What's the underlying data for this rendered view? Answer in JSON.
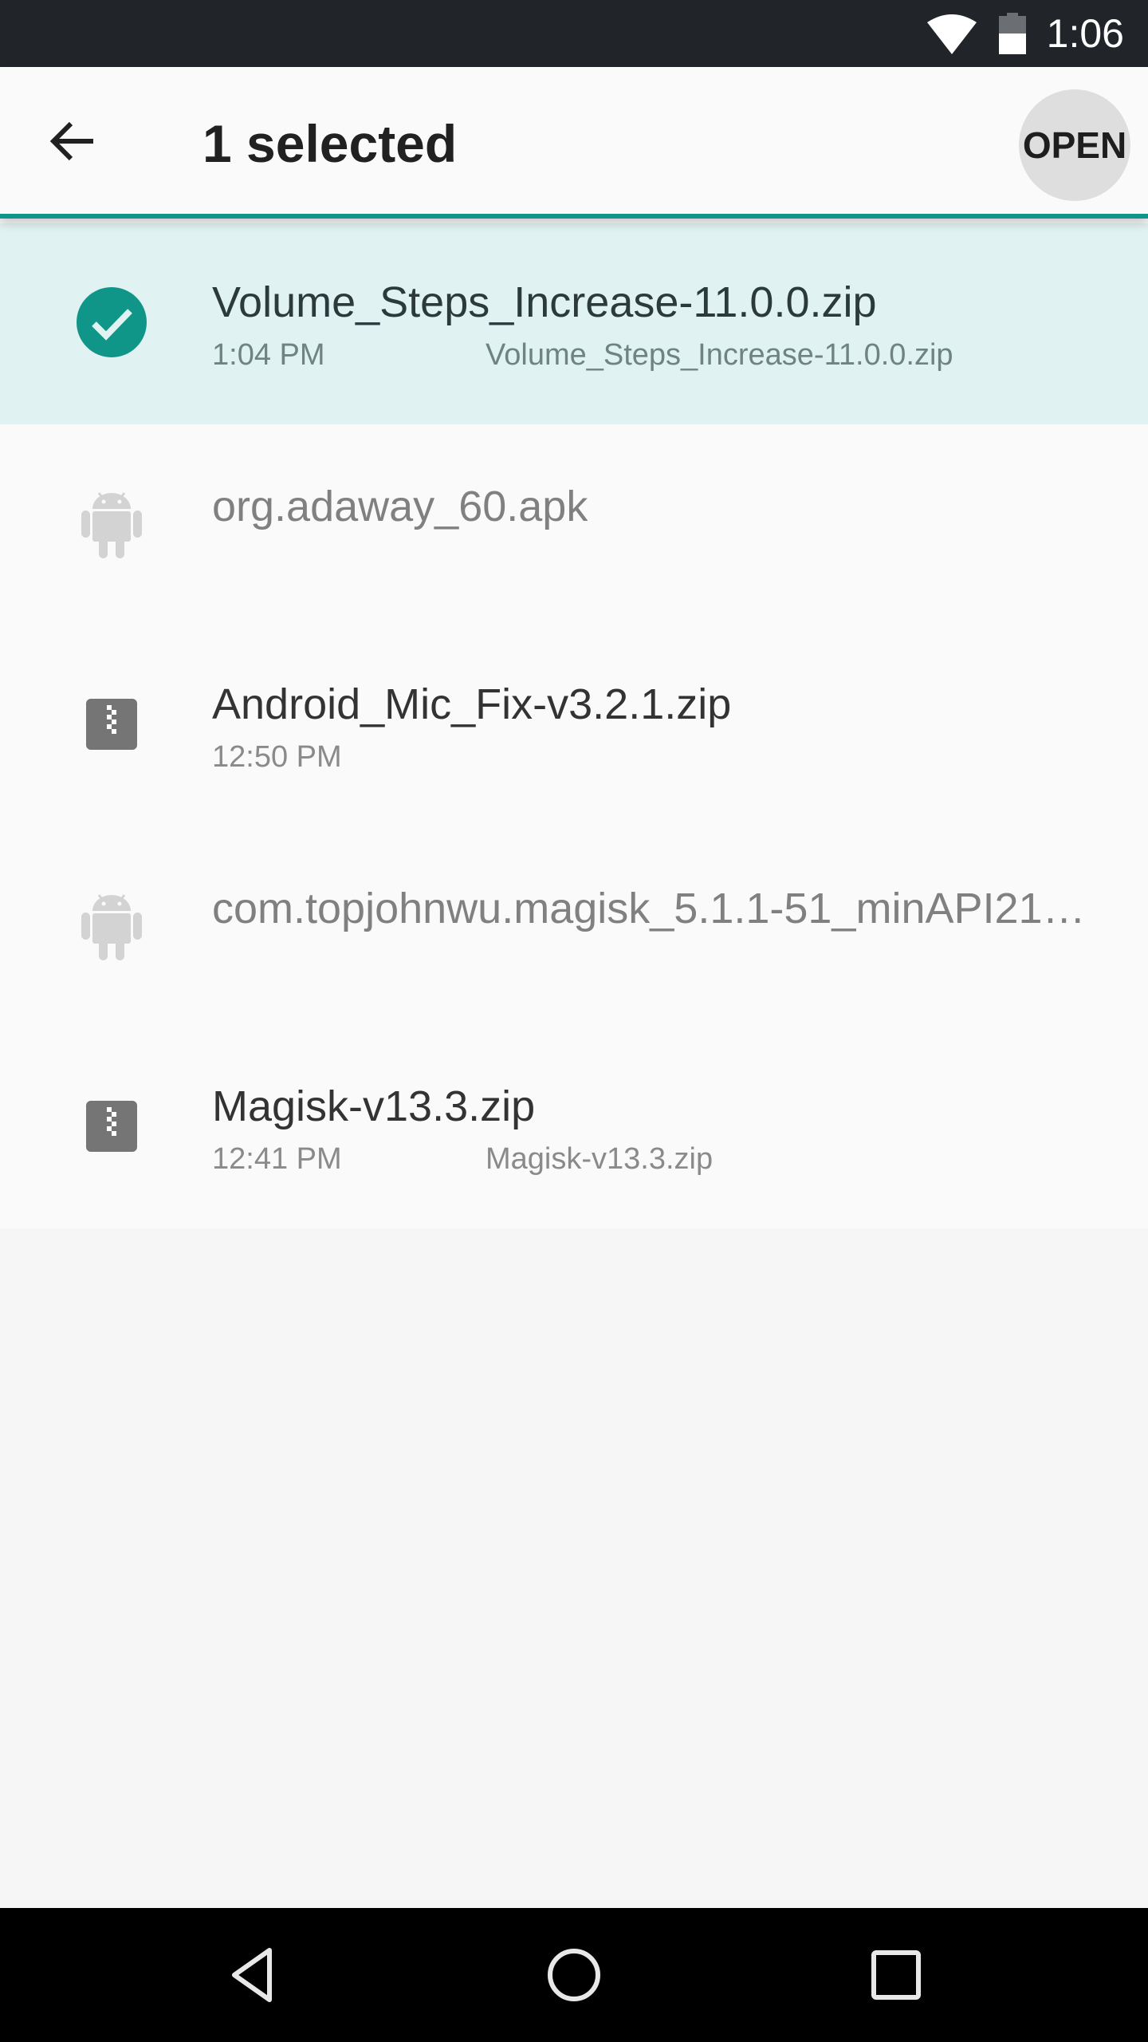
{
  "status_bar": {
    "time": "1:06",
    "icons": [
      "wifi-icon",
      "battery-icon"
    ],
    "battery_level": 0.5
  },
  "action_bar": {
    "back_icon": "arrow-back-icon",
    "title": "1 selected",
    "open_label": "OPEN"
  },
  "colors": {
    "accent": "#0f9688",
    "selected_row_bg": "#e0f2f1",
    "status_bar_bg": "#21252a",
    "nav_bar_bg": "#000000"
  },
  "files": [
    {
      "name": "Volume_Steps_Increase-11.0.0.zip",
      "time": "1:04 PM",
      "summary": "Volume_Steps_Increase-11.0.0.zip",
      "icon": "check-circle-icon",
      "selected": true,
      "enabled": true
    },
    {
      "name": "org.adaway_60.apk",
      "time": "",
      "summary": "",
      "icon": "android-icon",
      "selected": false,
      "enabled": false
    },
    {
      "name": "Android_Mic_Fix-v3.2.1.zip",
      "time": "12:50 PM",
      "summary": "",
      "icon": "zip-file-icon",
      "selected": false,
      "enabled": true
    },
    {
      "name": "com.topjohnwu.magisk_5.1.1-51_minAPI21…",
      "time": "",
      "summary": "",
      "icon": "android-icon",
      "selected": false,
      "enabled": false
    },
    {
      "name": "Magisk-v13.3.zip",
      "time": "12:41 PM",
      "summary": "Magisk-v13.3.zip",
      "icon": "zip-file-icon",
      "selected": false,
      "enabled": true
    }
  ],
  "nav_bar": {
    "buttons": [
      "back-nav-icon",
      "home-nav-icon",
      "recents-nav-icon"
    ]
  }
}
